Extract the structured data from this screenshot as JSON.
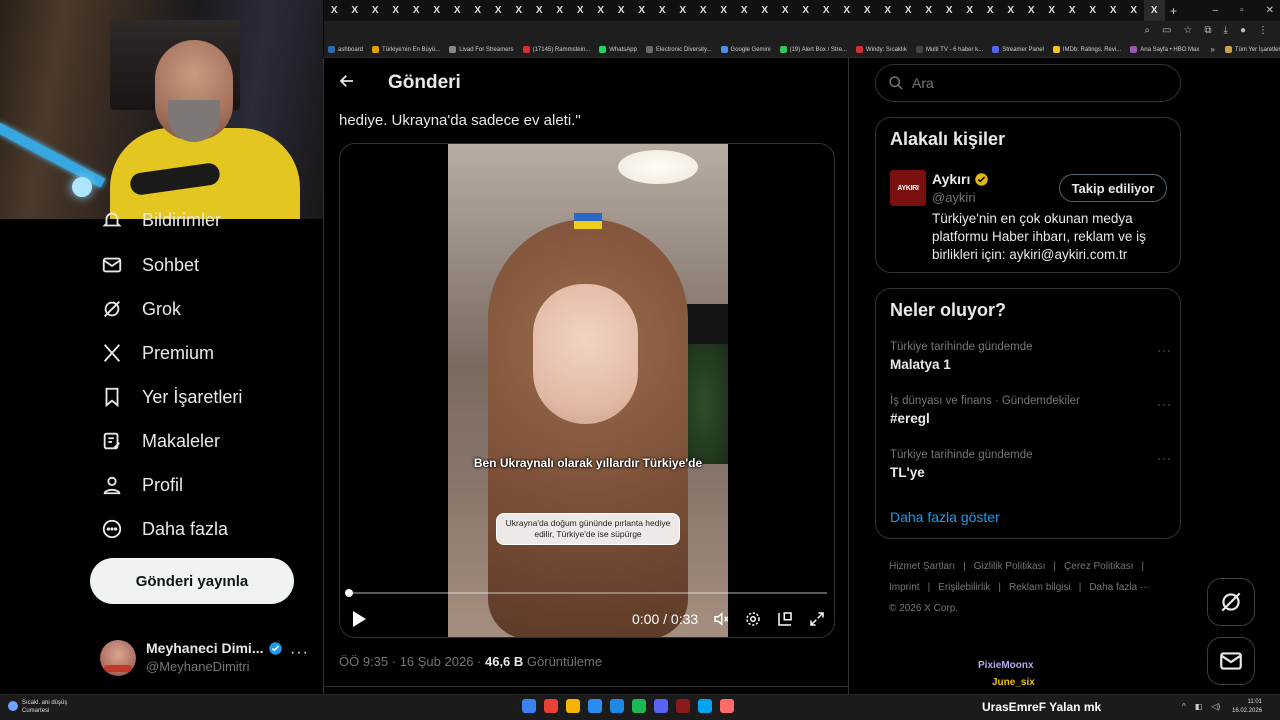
{
  "browser": {
    "tab_glyph": "X",
    "tab_count": 41,
    "new_tab": "+",
    "window_controls": [
      "–",
      "▫",
      "✕"
    ],
    "bookmarks": [
      {
        "label": "ashboard",
        "color": "#2b6cb0"
      },
      {
        "label": "Türkiye'nin En Büyü...",
        "color": "#e0a000"
      },
      {
        "label": "Livad For Streamers",
        "color": "#888888"
      },
      {
        "label": "(17145) Rammstein...",
        "color": "#e02b2b"
      },
      {
        "label": "WhatsApp",
        "color": "#25d366"
      },
      {
        "label": "Electronic Diversity...",
        "color": "#6b6b6b"
      },
      {
        "label": "Google Gemini",
        "color": "#4e8cf5"
      },
      {
        "label": "(19) Alert Box / Stre...",
        "color": "#34c759"
      },
      {
        "label": "Windy: Sıcaklık",
        "color": "#d32f2f"
      },
      {
        "label": "Multi TV - 6 haber k...",
        "color": "#444444"
      },
      {
        "label": "Streamer Panel",
        "color": "#5865f2"
      },
      {
        "label": "IMDb: Ratings, Revi...",
        "color": "#f5c518"
      },
      {
        "label": "Ana Sayfa • HBO Max",
        "color": "#9b59b6"
      }
    ],
    "bookmarks_more": "»",
    "all_bookmarks": "Tüm Yer İşaretleri"
  },
  "nav": {
    "items": [
      {
        "label": "Bildirimler",
        "icon": "bell-icon"
      },
      {
        "label": "Sohbet",
        "icon": "mail-icon"
      },
      {
        "label": "Grok",
        "icon": "grok-icon"
      },
      {
        "label": "Premium",
        "icon": "x-logo-icon"
      },
      {
        "label": "Yer İşaretleri",
        "icon": "bookmark-icon"
      },
      {
        "label": "Makaleler",
        "icon": "article-icon"
      },
      {
        "label": "Profil",
        "icon": "person-icon"
      },
      {
        "label": "Daha fazla",
        "icon": "more-circle-icon"
      }
    ],
    "post_button": "Gönderi yayınla",
    "profile": {
      "name": "Meyhaneci Dimi...",
      "handle": "@MeyhaneDimitri",
      "more": "···"
    }
  },
  "header": {
    "title": "Gönderi"
  },
  "tweet": {
    "text_partial_top": "...",
    "text": "hediye. Ukrayna'da sadece ev aleti.\"",
    "video": {
      "caption_main": "Ben Ukraynalı olarak yıllardır Türkiye'de",
      "caption_box": "Ukrayna'da doğum gününde pırlanta hediye edilir, Türkiye'de ise süpürge",
      "time": "0:00 / 0:33",
      "progress": 0
    },
    "meta_time": "ÖÖ 9:35 · 16 Şub 2026 · ",
    "views_count": "46,6 B",
    "views_label": " Görüntüleme"
  },
  "sidebar": {
    "search_placeholder": "Ara",
    "related": {
      "title": "Alakalı kişiler",
      "avatar_text": "AYKIRI",
      "name": "Aykırı",
      "handle": "@aykiri",
      "button": "Takip ediliyor",
      "bio": "Türkiye'nin en çok okunan medya platformu Haber ihbarı, reklam ve iş birlikleri için: aykiri@aykiri.com.tr"
    },
    "trends": {
      "title": "Neler oluyor?",
      "items": [
        {
          "context": "Türkiye tarihinde gündemde",
          "name": "Malatya 1"
        },
        {
          "context": "İş dünyası ve finans · Gündemdekiler",
          "name": "#eregl"
        },
        {
          "context": "Türkiye tarihinde gündemde",
          "name": "TL'ye"
        }
      ],
      "show_more": "Daha fazla göster"
    },
    "footer": {
      "links_row1": [
        "Hizmet Şartları",
        "|",
        "Gizlilik Politikası",
        "|",
        "Çerez Politikası",
        "|"
      ],
      "links_row2": [
        "Imprint",
        "|",
        "Erişilebilirlik",
        "|",
        "Reklam bilgisi",
        "|",
        "Daha fazla ···"
      ],
      "copyright": "© 2026 X Corp."
    }
  },
  "stream_chat": {
    "user1": "PixieMoonx",
    "user2": "June_six"
  },
  "taskbar": {
    "weather_line1": "Sıcakl. ani düşüş",
    "weather_line2": "Cumartesi",
    "apps": [
      "#3b82f6",
      "#e94235",
      "#f4b400",
      "#2d8cf0",
      "#1e88e5",
      "#1db954",
      "#5865f2",
      "#8b1a1a",
      "#00a4ef",
      "#ff6b6b"
    ],
    "user_text": "UrasEmreF  Yalan mk",
    "time": "11:01",
    "date": "16.02.2026"
  }
}
